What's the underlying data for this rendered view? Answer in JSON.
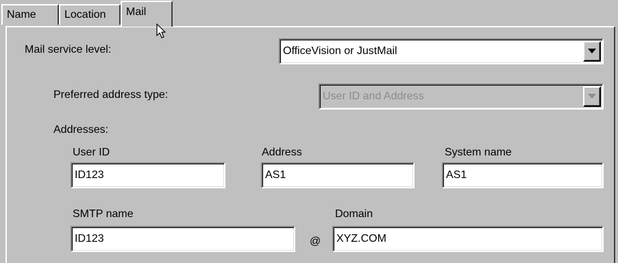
{
  "tabs": {
    "name": "Name",
    "location": "Location",
    "mail": "Mail"
  },
  "mail_service": {
    "label": "Mail service level:",
    "value": "OfficeVision or JustMail"
  },
  "preferred_address": {
    "label": "Preferred address type:",
    "value": "User ID and Address"
  },
  "addresses": {
    "label": "Addresses:",
    "user_id": {
      "label": "User ID",
      "value": "ID123"
    },
    "address": {
      "label": "Address",
      "value": "AS1"
    },
    "system_name": {
      "label": "System name",
      "value": "AS1"
    },
    "smtp_name": {
      "label": "SMTP name",
      "value": "ID123"
    },
    "at_sign": "@",
    "domain": {
      "label": "Domain",
      "value": "XYZ.COM"
    }
  },
  "icons": {
    "cursor": "arrow-cursor-icon",
    "dropdown": "chevron-down-icon"
  }
}
